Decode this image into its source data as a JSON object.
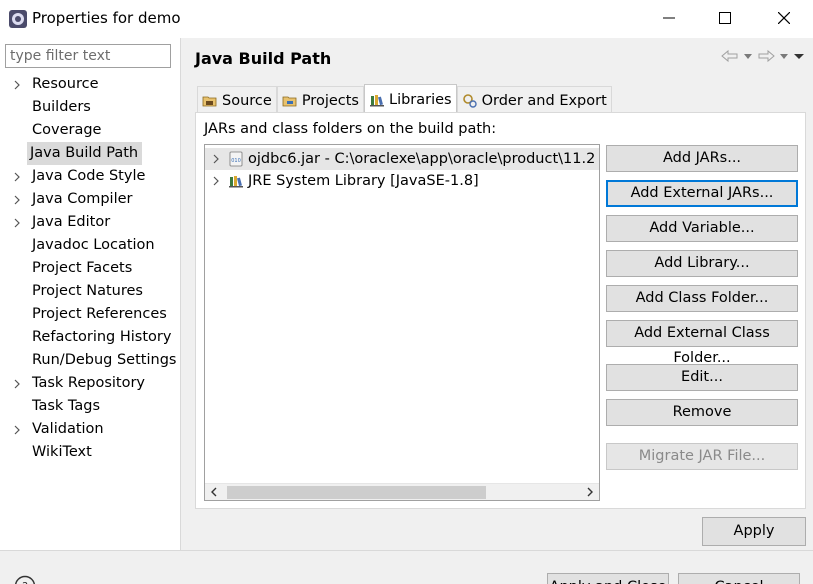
{
  "window": {
    "title": "Properties for demo",
    "icon": "eclipse-gear-icon"
  },
  "filter": {
    "placeholder": "type filter text",
    "value": ""
  },
  "nav": {
    "items": [
      {
        "label": "Resource",
        "expandable": true
      },
      {
        "label": "Builders",
        "expandable": false
      },
      {
        "label": "Coverage",
        "expandable": false
      },
      {
        "label": "Java Build Path",
        "expandable": false,
        "selected": true
      },
      {
        "label": "Java Code Style",
        "expandable": true
      },
      {
        "label": "Java Compiler",
        "expandable": true
      },
      {
        "label": "Java Editor",
        "expandable": true
      },
      {
        "label": "Javadoc Location",
        "expandable": false
      },
      {
        "label": "Project Facets",
        "expandable": false
      },
      {
        "label": "Project Natures",
        "expandable": false
      },
      {
        "label": "Project References",
        "expandable": false
      },
      {
        "label": "Refactoring History",
        "expandable": false
      },
      {
        "label": "Run/Debug Settings",
        "expandable": false
      },
      {
        "label": "Task Repository",
        "expandable": true
      },
      {
        "label": "Task Tags",
        "expandable": false
      },
      {
        "label": "Validation",
        "expandable": true
      },
      {
        "label": "WikiText",
        "expandable": false
      }
    ]
  },
  "page": {
    "title": "Java Build Path",
    "tabs": [
      {
        "label": "Source",
        "icon": "source-folder-icon"
      },
      {
        "label": "Projects",
        "icon": "project-folder-icon"
      },
      {
        "label": "Libraries",
        "icon": "libraries-icon",
        "active": true
      },
      {
        "label": "Order and Export",
        "icon": "order-export-icon"
      }
    ],
    "description": "JARs and class folders on the build path:",
    "tree": [
      {
        "label": "ojdbc6.jar - C:\\oraclexe\\app\\oracle\\product\\11.2",
        "icon": "jar-icon",
        "selected": true
      },
      {
        "label": "JRE System Library [JavaSE-1.8]",
        "icon": "library-icon",
        "selected": false
      }
    ],
    "buttons": {
      "add_jars": "Add JARs...",
      "add_external_jars": "Add External JARs...",
      "add_variable": "Add Variable...",
      "add_library": "Add Library...",
      "add_class_folder": "Add Class Folder...",
      "add_external_class_folder": "Add External Class Folder...",
      "edit": "Edit...",
      "remove": "Remove",
      "migrate_jar": "Migrate JAR File..."
    },
    "apply": "Apply"
  },
  "footer": {
    "ok": "Apply and Close",
    "cancel": "Cancel"
  }
}
